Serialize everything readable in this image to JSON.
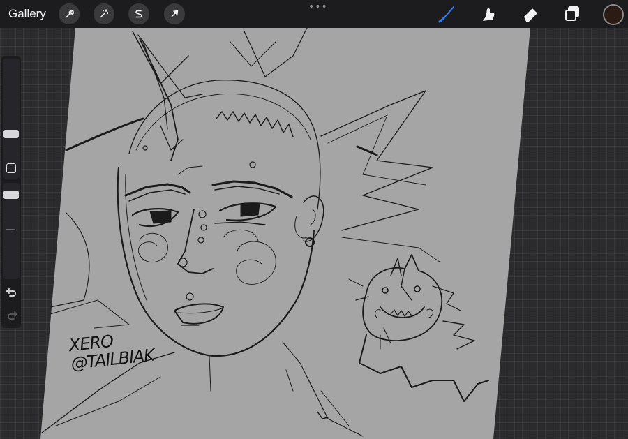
{
  "toolbar": {
    "gallery_label": "Gallery",
    "left_tools": [
      {
        "name": "actions",
        "icon": "wrench-icon"
      },
      {
        "name": "adjustments",
        "icon": "magic-wand-icon"
      },
      {
        "name": "selection",
        "icon": "selection-s-icon"
      },
      {
        "name": "transform",
        "icon": "arrow-cursor-icon"
      }
    ],
    "more_label": "•••",
    "right_tools": [
      {
        "name": "brush",
        "icon": "brush-icon",
        "active": true,
        "accent": "#2f7cf6"
      },
      {
        "name": "smudge",
        "icon": "smudge-finger-icon"
      },
      {
        "name": "eraser",
        "icon": "eraser-icon"
      },
      {
        "name": "layers",
        "icon": "layers-icon"
      }
    ],
    "current_color": "#2a1c14"
  },
  "sidebar": {
    "brush_size_level": 0.38,
    "brush_opacity_level": 0.9,
    "modifier_button": "square-icon",
    "undo": "undo-icon",
    "redo": "redo-icon"
  },
  "canvas": {
    "paper_color": "#a5a5a5",
    "signature_line1": "XERO",
    "signature_line2": "@TAILBlAK"
  }
}
